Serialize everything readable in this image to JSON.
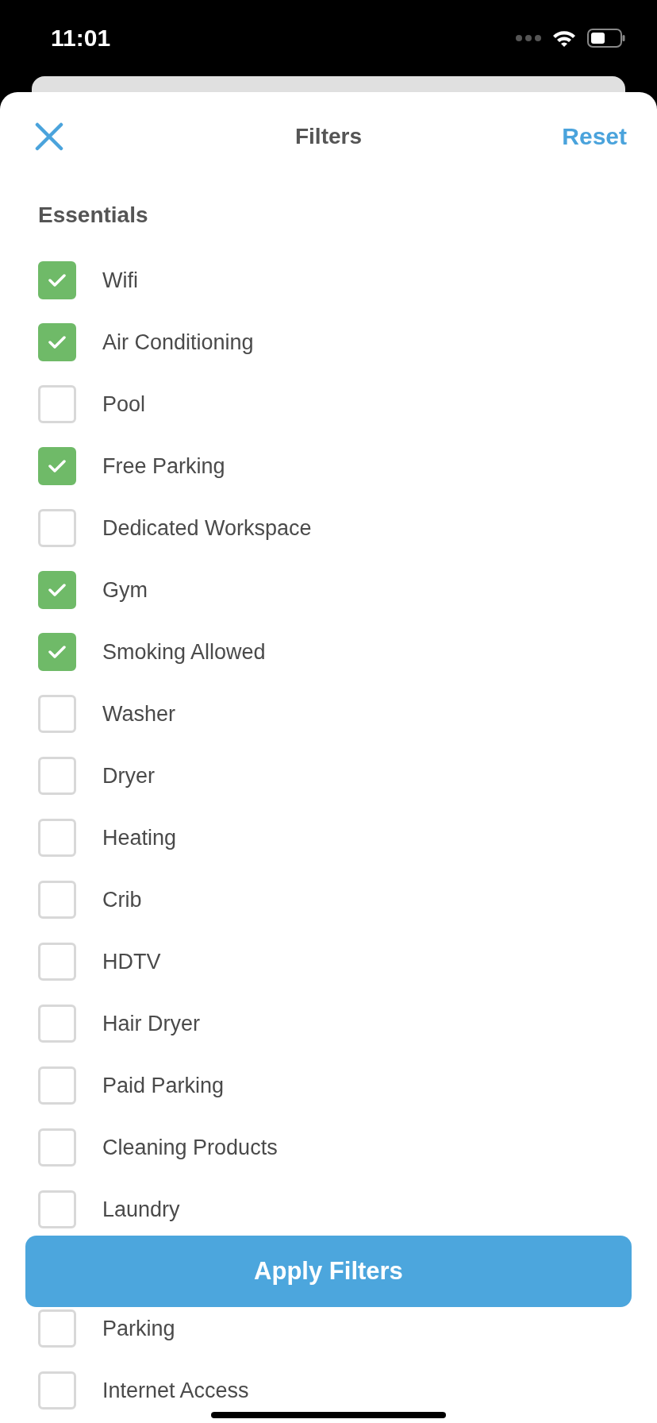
{
  "status_bar": {
    "time": "11:01"
  },
  "header": {
    "title": "Filters",
    "reset": "Reset"
  },
  "section": {
    "title": "Essentials"
  },
  "amenities": [
    {
      "label": "Wifi",
      "checked": true
    },
    {
      "label": "Air Conditioning",
      "checked": true
    },
    {
      "label": "Pool",
      "checked": false
    },
    {
      "label": "Free Parking",
      "checked": true
    },
    {
      "label": "Dedicated Workspace",
      "checked": false
    },
    {
      "label": "Gym",
      "checked": true
    },
    {
      "label": "Smoking Allowed",
      "checked": true
    },
    {
      "label": "Washer",
      "checked": false
    },
    {
      "label": "Dryer",
      "checked": false
    },
    {
      "label": "Heating",
      "checked": false
    },
    {
      "label": "Crib",
      "checked": false
    },
    {
      "label": "HDTV",
      "checked": false
    },
    {
      "label": "Hair Dryer",
      "checked": false
    },
    {
      "label": "Paid Parking",
      "checked": false
    },
    {
      "label": "Cleaning Products",
      "checked": false
    },
    {
      "label": "Laundry",
      "checked": false
    },
    {
      "label": "Parking",
      "checked": false
    },
    {
      "label": "Internet Access",
      "checked": false
    }
  ],
  "apply_button": "Apply Filters"
}
